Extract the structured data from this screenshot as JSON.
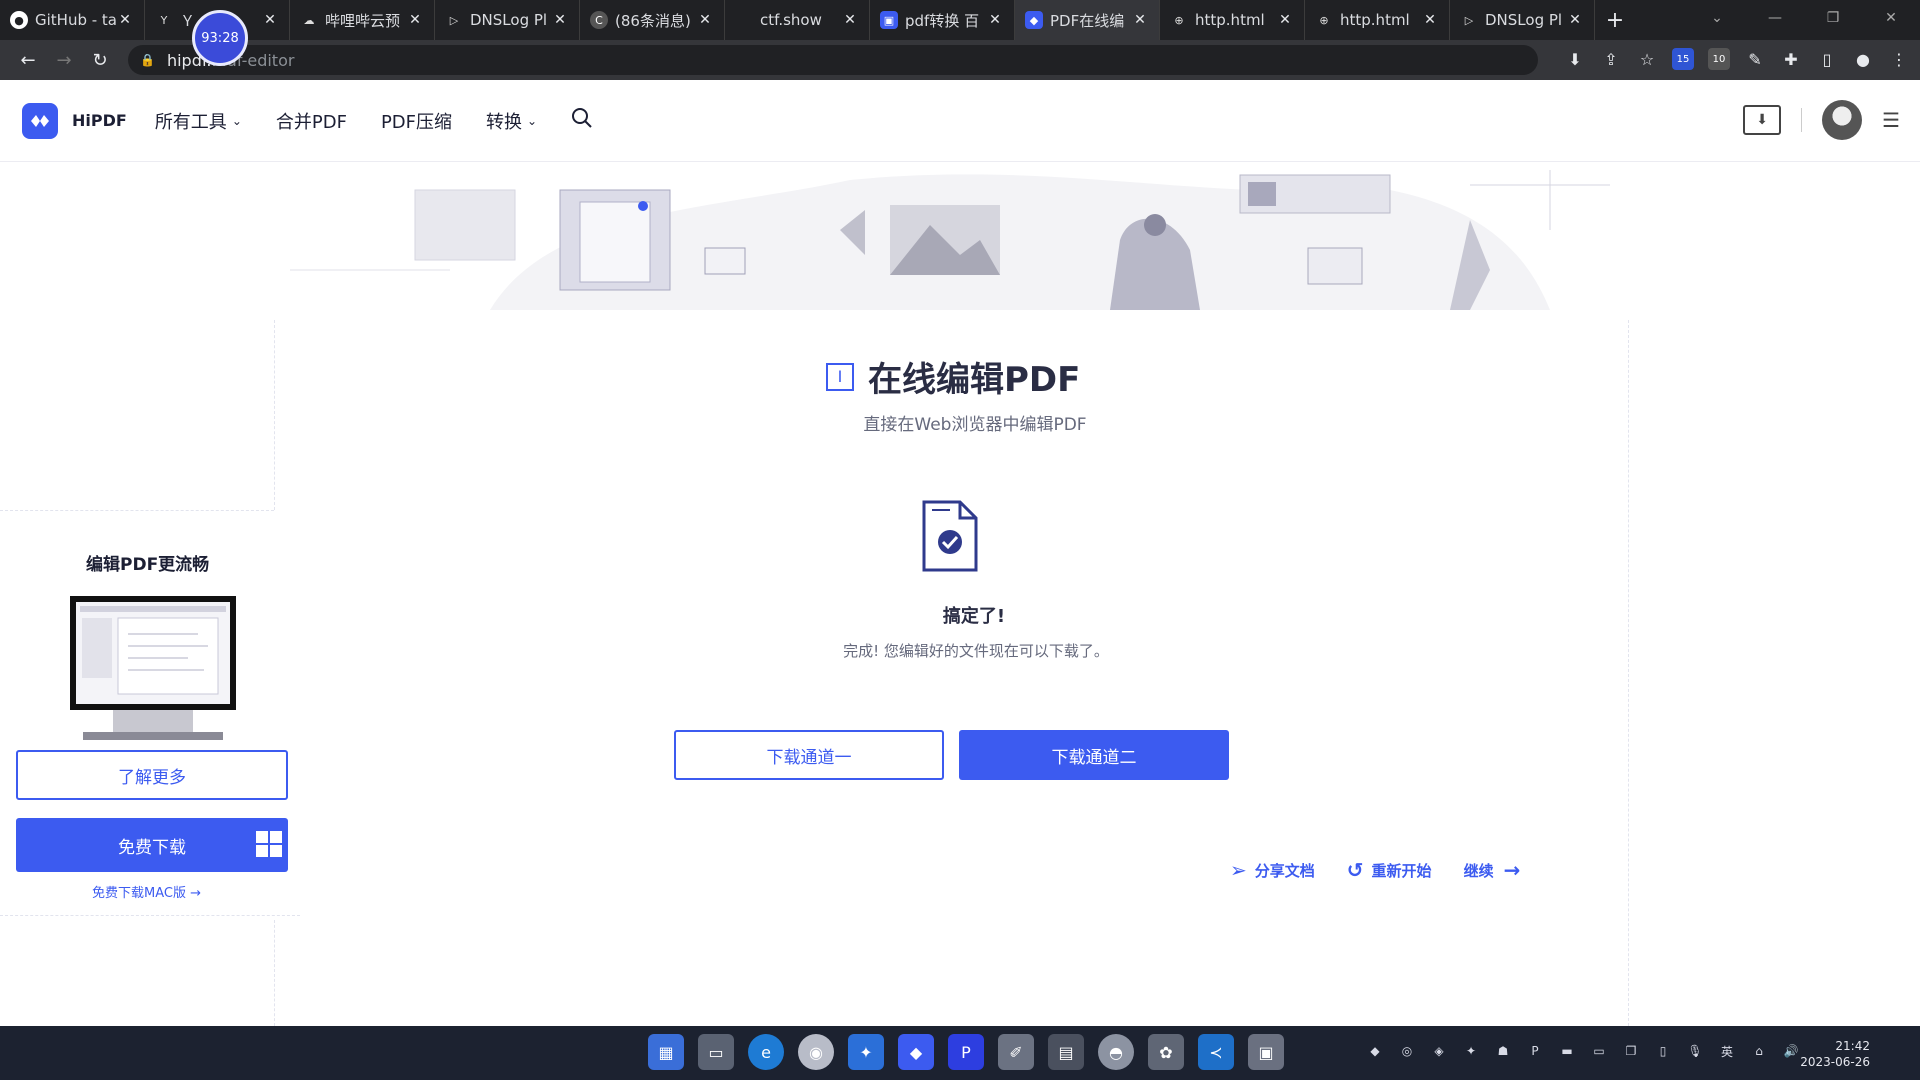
{
  "browser": {
    "tabs": [
      {
        "title": "GitHub - ta",
        "icon": "github-icon"
      },
      {
        "title": "Ｙ",
        "icon": "y-icon"
      },
      {
        "title": "哔哩哔云预",
        "icon": "cloud-icon"
      },
      {
        "title": "DNSLog Pl",
        "icon": "dnslog-icon"
      },
      {
        "title": "(86条消息)",
        "icon": "csdn-icon"
      },
      {
        "title": "ctf.show",
        "icon": "ctfshow-icon"
      },
      {
        "title": "pdf转换 百",
        "icon": "pdf-icon"
      },
      {
        "title": "PDF在线编",
        "icon": "hipdf-icon"
      },
      {
        "title": "http.html",
        "icon": "globe-icon"
      },
      {
        "title": "http.html",
        "icon": "globe-icon"
      },
      {
        "title": "DNSLog Pl",
        "icon": "dnslog-icon"
      }
    ],
    "active_tab": 7,
    "timer_badge": "93:28",
    "address": {
      "host": "hipdf.",
      "path": "...df-editor"
    },
    "extension_badges": [
      "15",
      "10"
    ]
  },
  "site": {
    "logo": "HiPDF",
    "nav": {
      "all_tools": "所有工具",
      "merge": "合并PDF",
      "compress": "PDF压缩",
      "convert": "转换"
    },
    "brand_color": "#3c5bf0"
  },
  "promo": {
    "title": "编辑PDF更流畅",
    "learn_more": "了解更多",
    "free_download": "免费下载",
    "mac_link": "免费下载MAC版"
  },
  "main": {
    "title": "在线编辑PDF",
    "subtitle": "直接在Web浏览器中编辑PDF",
    "done_heading": "搞定了!",
    "done_message": "完成! 您编辑好的文件现在可以下载了。",
    "download_channel_1": "下载通道一",
    "download_channel_2": "下载通道二",
    "actions": {
      "share": "分享文档",
      "restart": "重新开始",
      "continue": "继续"
    }
  },
  "taskbar": {
    "time": "21:42",
    "date": "2023-06-26",
    "ime": "英"
  }
}
